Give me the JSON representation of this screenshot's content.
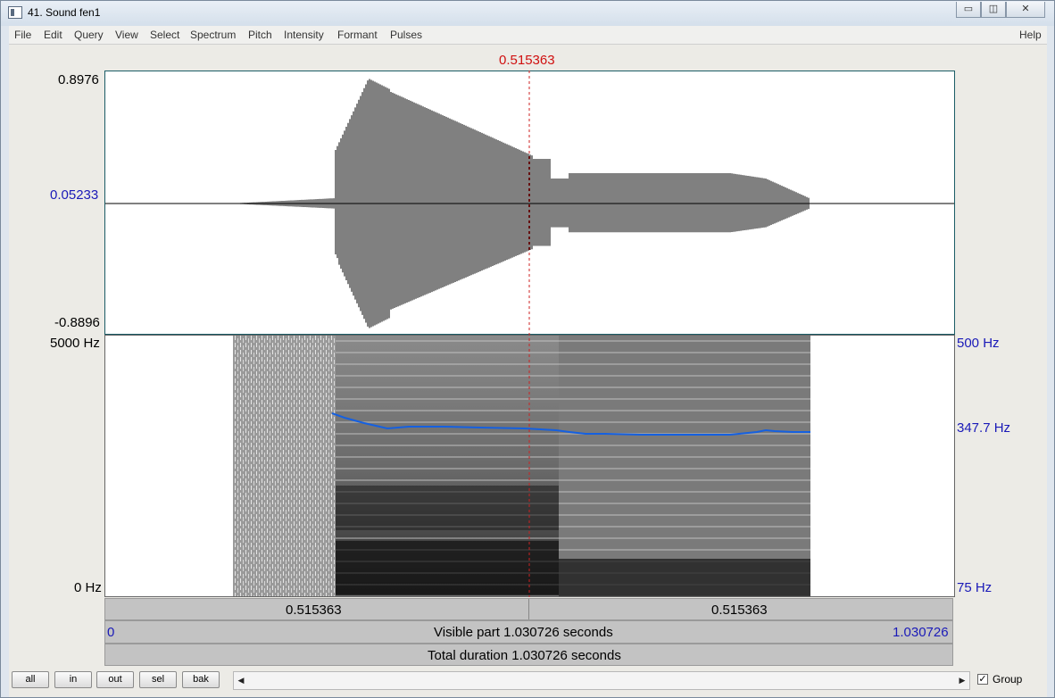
{
  "window": {
    "title": "41. Sound fen1",
    "minimize": "▭",
    "restore": "◫",
    "close": "✕"
  },
  "menu": [
    "File",
    "Edit",
    "Query",
    "View",
    "Select",
    "Spectrum",
    "Pitch",
    "Intensity",
    "Formant",
    "Pulses"
  ],
  "menu_help": "Help",
  "cursor": {
    "time_label": "0.515363"
  },
  "waveform": {
    "ymax": "0.8976",
    "ycursor": "0.05233",
    "ymin": "-0.8896"
  },
  "spectrogram": {
    "fmax": "5000 Hz",
    "fmin": "0 Hz"
  },
  "pitch": {
    "max": "500 Hz",
    "value": "347.7 Hz",
    "min": "75 Hz"
  },
  "time_bars": {
    "left_part": "0.515363",
    "right_part": "0.515363",
    "visible_start": "0",
    "visible_label": "Visible part 1.030726 seconds",
    "visible_end": "1.030726",
    "total_label": "Total duration 1.030726 seconds"
  },
  "buttons": {
    "all": "all",
    "in": "in",
    "out": "out",
    "sel": "sel",
    "bak": "bak"
  },
  "group": {
    "label": "Group",
    "checked": true
  }
}
